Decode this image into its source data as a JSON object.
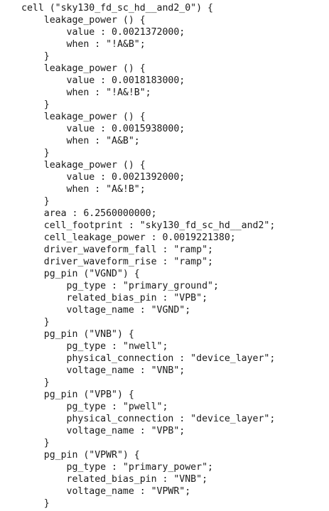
{
  "document": {
    "lines": [
      "cell (\"sky130_fd_sc_hd__and2_0\") {",
      "    leakage_power () {",
      "        value : 0.0021372000;",
      "        when : \"!A&B\";",
      "    }",
      "    leakage_power () {",
      "        value : 0.0018183000;",
      "        when : \"!A&!B\";",
      "    }",
      "    leakage_power () {",
      "        value : 0.0015938000;",
      "        when : \"A&B\";",
      "    }",
      "    leakage_power () {",
      "        value : 0.0021392000;",
      "        when : \"A&!B\";",
      "    }",
      "    area : 6.2560000000;",
      "    cell_footprint : \"sky130_fd_sc_hd__and2\";",
      "    cell_leakage_power : 0.0019221380;",
      "    driver_waveform_fall : \"ramp\";",
      "    driver_waveform_rise : \"ramp\";",
      "    pg_pin (\"VGND\") {",
      "        pg_type : \"primary_ground\";",
      "        related_bias_pin : \"VPB\";",
      "        voltage_name : \"VGND\";",
      "    }",
      "    pg_pin (\"VNB\") {",
      "        pg_type : \"nwell\";",
      "        physical_connection : \"device_layer\";",
      "        voltage_name : \"VNB\";",
      "    }",
      "    pg_pin (\"VPB\") {",
      "        pg_type : \"pwell\";",
      "        physical_connection : \"device_layer\";",
      "        voltage_name : \"VPB\";",
      "    }",
      "    pg_pin (\"VPWR\") {",
      "        pg_type : \"primary_power\";",
      "        related_bias_pin : \"VNB\";",
      "        voltage_name : \"VPWR\";",
      "    }"
    ]
  }
}
